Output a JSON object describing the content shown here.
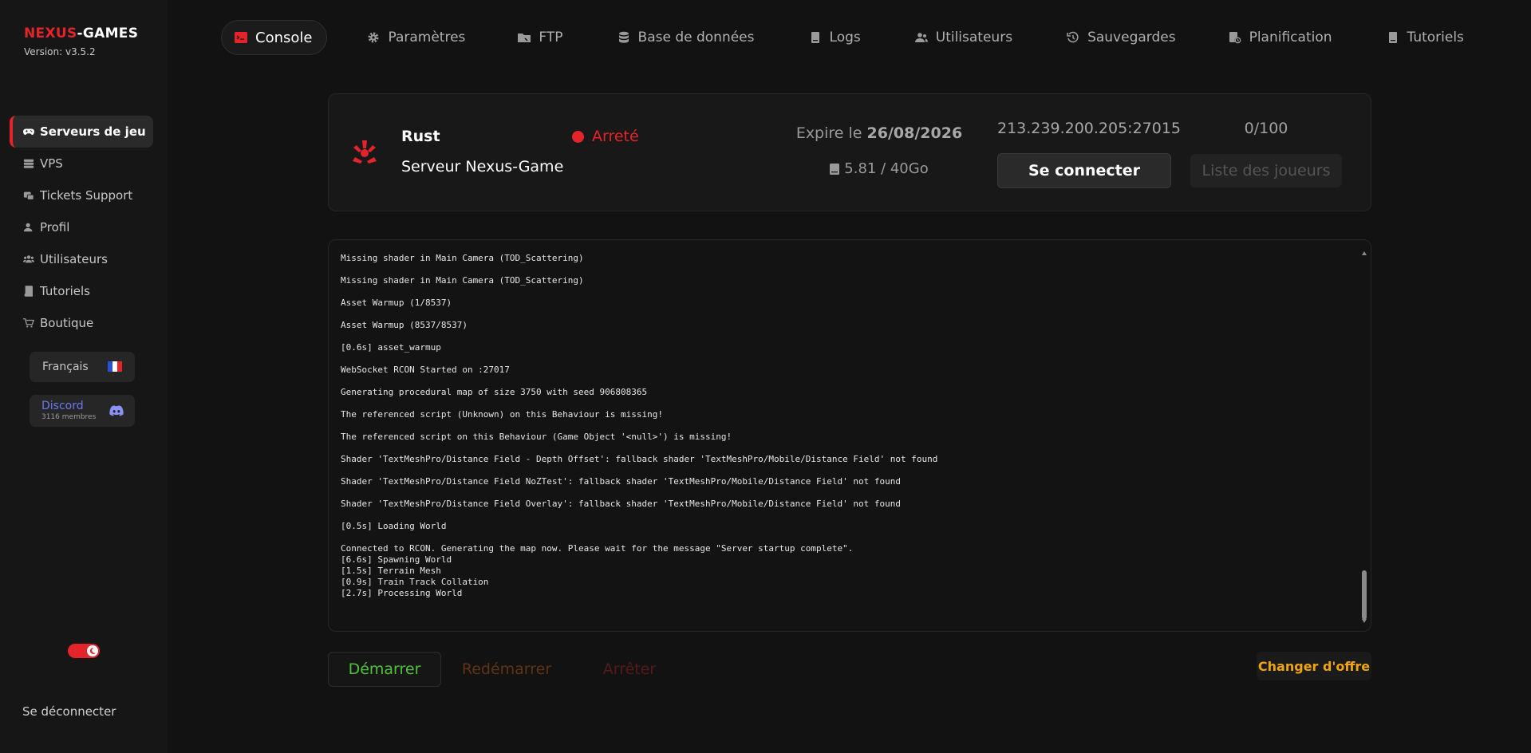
{
  "brand": {
    "name_prefix": "NEXUS",
    "name_suffix": "-GAMES",
    "version": "Version: v3.5.2"
  },
  "sidebar": {
    "items": [
      {
        "label": "Serveurs de jeu",
        "icon": "gamepad-icon"
      },
      {
        "label": "VPS",
        "icon": "server-icon"
      },
      {
        "label": "Tickets Support",
        "icon": "ticket-icon"
      },
      {
        "label": "Profil",
        "icon": "profile-icon"
      },
      {
        "label": "Utilisateurs",
        "icon": "users-icon"
      },
      {
        "label": "Tutoriels",
        "icon": "book-icon"
      },
      {
        "label": "Boutique",
        "icon": "cart-icon"
      }
    ],
    "language": "Français",
    "discord": {
      "title": "Discord",
      "members": "3116 membres"
    },
    "logout": "Se déconnecter"
  },
  "topnav": {
    "tabs": [
      {
        "label": "Console",
        "icon": "console-icon"
      },
      {
        "label": "Paramètres",
        "icon": "gear-icon"
      },
      {
        "label": "FTP",
        "icon": "folder-icon"
      },
      {
        "label": "Base de données",
        "icon": "database-icon"
      },
      {
        "label": "Logs",
        "icon": "logs-icon"
      },
      {
        "label": "Utilisateurs",
        "icon": "users-icon"
      },
      {
        "label": "Sauvegardes",
        "icon": "backup-icon"
      },
      {
        "label": "Planification",
        "icon": "schedule-icon"
      },
      {
        "label": "Tutoriels",
        "icon": "book-icon"
      }
    ]
  },
  "server": {
    "game": "Rust",
    "name": "Serveur Nexus-Game",
    "status": "Arreté",
    "expire_prefix": "Expire le ",
    "expire_date": "26/08/2026",
    "storage": "5.81 / 40Go",
    "ip": "213.239.200.205:27015",
    "players": "0/100",
    "connect_label": "Se connecter",
    "players_list_label": "Liste des joueurs"
  },
  "console": {
    "lines": [
      "Missing shader in Main Camera (TOD_Scattering)",
      "Missing shader in Main Camera (TOD_Scattering)",
      "Asset Warmup (1/8537)",
      "Asset Warmup (8537/8537)",
      "[0.6s] asset_warmup",
      "WebSocket RCON Started on :27017",
      "Generating procedural map of size 3750 with seed 906808365",
      "The referenced script (Unknown) on this Behaviour is missing!",
      "The referenced script on this Behaviour (Game Object '<null>') is missing!",
      "Shader 'TextMeshPro/Distance Field - Depth Offset': fallback shader 'TextMeshPro/Mobile/Distance Field' not found",
      "Shader 'TextMeshPro/Distance Field NoZTest': fallback shader 'TextMeshPro/Mobile/Distance Field' not found",
      "Shader 'TextMeshPro/Distance Field Overlay': fallback shader 'TextMeshPro/Mobile/Distance Field' not found",
      "[0.5s] Loading World",
      "Connected to RCON. Generating the map now. Please wait for the message \"Server startup complete\".",
      "[6.6s] Spawning World",
      "[1.5s] Terrain Mesh",
      "[0.9s] Train Track Collation",
      "[2.7s] Processing World"
    ]
  },
  "actions": {
    "start": "Démarrer",
    "restart": "Redémarrer",
    "stop": "Arrêter",
    "change_offer": "Changer d'offre"
  },
  "colors": {
    "accent": "#e3252b",
    "start": "#4fc23a",
    "offer": "#f0a50a",
    "discord": "#6b78f0"
  }
}
